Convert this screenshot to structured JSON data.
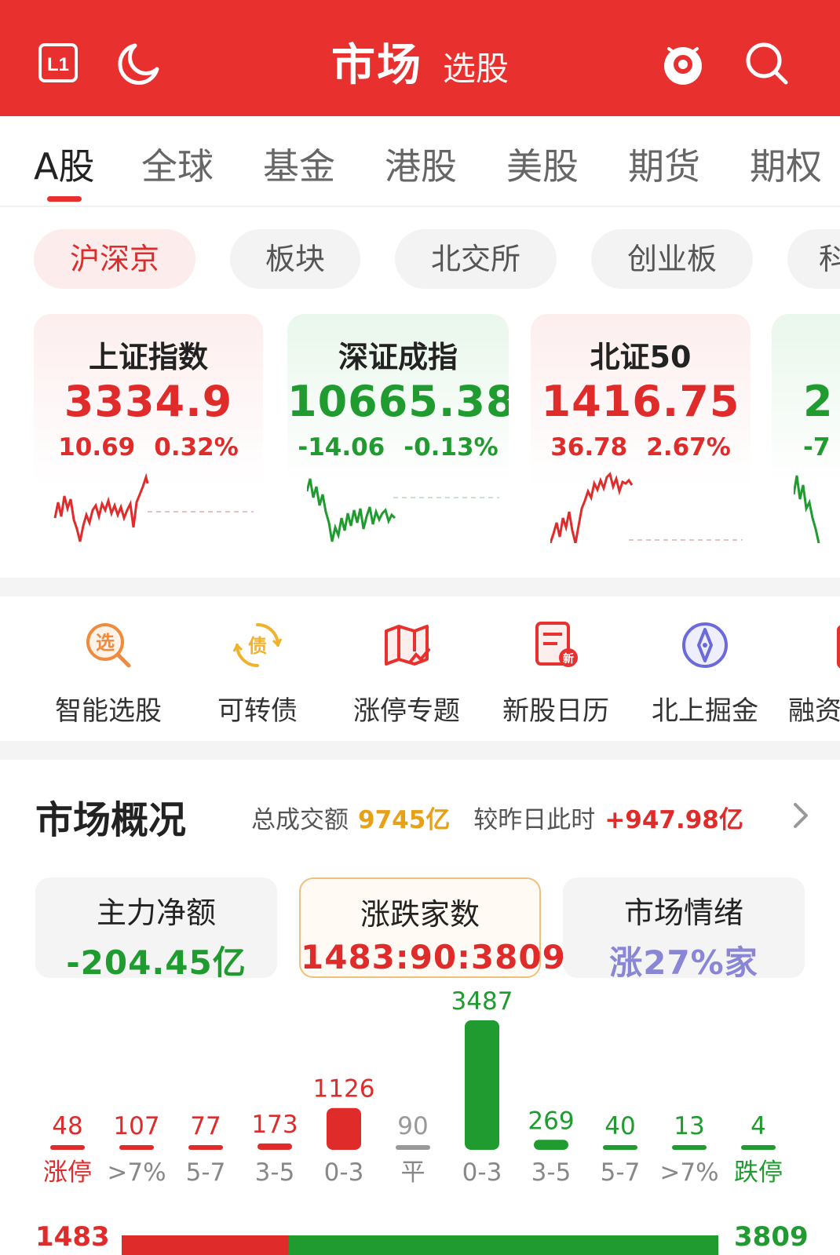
{
  "header": {
    "title": "市场",
    "subtitle": "选股",
    "l1_label": "L1"
  },
  "tabs": [
    {
      "label": "A股",
      "active": true
    },
    {
      "label": "全球"
    },
    {
      "label": "基金"
    },
    {
      "label": "港股"
    },
    {
      "label": "美股"
    },
    {
      "label": "期货"
    },
    {
      "label": "期权"
    }
  ],
  "pills": [
    {
      "label": "沪深京",
      "active": true
    },
    {
      "label": "板块"
    },
    {
      "label": "北交所"
    },
    {
      "label": "创业板"
    },
    {
      "label": "科"
    }
  ],
  "indices": [
    {
      "name": "上证指数",
      "value": "3334.9",
      "change": "10.69",
      "pct": "0.32%",
      "trend": "up"
    },
    {
      "name": "深证成指",
      "value": "10665.38",
      "change": "-14.06",
      "pct": "-0.13%",
      "trend": "down"
    },
    {
      "name": "北证50",
      "value": "1416.75",
      "change": "36.78",
      "pct": "2.67%",
      "trend": "up"
    },
    {
      "name": "",
      "value": "2",
      "change": "-7",
      "pct": "",
      "trend": "down"
    }
  ],
  "tools": [
    {
      "label": "智能选股",
      "icon": "select-icon",
      "glyph": "选",
      "color": "#f08a3c"
    },
    {
      "label": "可转债",
      "icon": "bond-icon",
      "glyph": "债",
      "color": "#f0b12c"
    },
    {
      "label": "涨停专题",
      "icon": "map-icon",
      "color": "#e8302f"
    },
    {
      "label": "新股日历",
      "icon": "calendar-icon",
      "color": "#e8302f"
    },
    {
      "label": "北上掘金",
      "icon": "compass-icon",
      "color": "#6a6adb"
    },
    {
      "label": "融资",
      "icon": "finance-icon",
      "color": "#e8302f"
    }
  ],
  "overview": {
    "title": "市场概况",
    "turnover_label": "总成交额",
    "turnover_value": "9745亿",
    "compare_label": "较昨日此时",
    "compare_value": "+947.98亿"
  },
  "boxes": [
    {
      "label": "主力净额",
      "value": "-204.45亿",
      "color": "#1f9b2f"
    },
    {
      "label": "涨跌家数",
      "value": "1483:90:3809",
      "color": "#e02b2b",
      "selected": true
    },
    {
      "label": "市场情绪",
      "value": "涨27%家",
      "color": "#8a86d6"
    }
  ],
  "chart_data": {
    "type": "bar",
    "categories": [
      "涨停",
      ">7%",
      "5-7",
      "3-5",
      "0-3",
      "平",
      "0-3",
      "3-5",
      "5-7",
      ">7%",
      "跌停"
    ],
    "values": [
      48,
      107,
      77,
      173,
      1126,
      90,
      3487,
      269,
      40,
      13,
      4
    ],
    "colors": [
      "#e02b2b",
      "#e02b2b",
      "#e02b2b",
      "#e02b2b",
      "#e02b2b",
      "#999999",
      "#1f9b2f",
      "#1f9b2f",
      "#1f9b2f",
      "#1f9b2f",
      "#1f9b2f"
    ],
    "ylim": [
      0,
      3487
    ]
  },
  "summary": {
    "up_count": "1483",
    "down_count": "3809",
    "up_color": "#e02b2b",
    "down_color": "#1f9b2f"
  }
}
